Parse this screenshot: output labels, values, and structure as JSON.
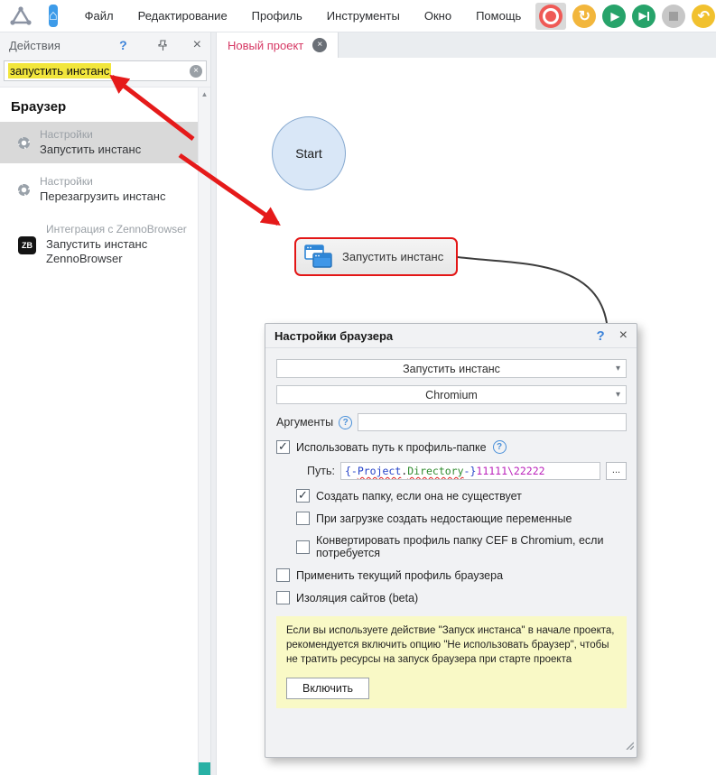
{
  "titlebar": {
    "menu": [
      "Файл",
      "Редактирование",
      "Профиль",
      "Инструменты",
      "Окно",
      "Помощь"
    ],
    "toolbar_icons": [
      "record",
      "restart",
      "play",
      "step",
      "stop",
      "undo",
      "redo",
      "hourglass",
      "profile"
    ]
  },
  "actions_panel": {
    "title": "Действия",
    "help_icon": "?",
    "search": {
      "value": "запустить инстанс"
    },
    "section_title": "Браузер",
    "items": [
      {
        "category": "Настройки",
        "label": "Запустить инстанс",
        "icon": "gear-icon",
        "selected": true
      },
      {
        "category": "Настройки",
        "label": "Перезагрузить инстанс",
        "icon": "gear-icon",
        "selected": false
      },
      {
        "category": "Интеграция с ZennoBrowser",
        "label": "Запустить инстанс ZennoBrowser",
        "icon": "zb-icon",
        "badge": "ZB",
        "selected": false
      }
    ]
  },
  "canvas": {
    "tab_label": "Новый проект",
    "start_node_label": "Start",
    "action_block_label": "Запустить инстанс"
  },
  "dialog": {
    "title": "Настройки браузера",
    "help_icon": "?",
    "action_select": "Запустить инстанс",
    "browser_select": "Chromium",
    "arguments_label": "Аргументы",
    "arguments_value": "",
    "use_profile_label": "Использовать путь к профиль-папке",
    "path_label": "Путь:",
    "path_segments": [
      {
        "text": "{-",
        "style": "macro"
      },
      {
        "text": "Project",
        "style": "macro-misspelled"
      },
      {
        "text": ".",
        "style": "plain"
      },
      {
        "text": "Directory",
        "style": "name-misspelled"
      },
      {
        "text": "-}",
        "style": "macro"
      },
      {
        "text": "11111\\22222",
        "style": "value"
      }
    ],
    "browse_button": "...",
    "checkboxes": [
      {
        "label": "Создать папку, если она не существует",
        "checked": true,
        "indent": true
      },
      {
        "label": "При загрузке создать недостающие переменные",
        "checked": false,
        "indent": true
      },
      {
        "label": "Конвертировать профиль папку CEF в Chromium, если потребуется",
        "checked": false,
        "indent": true
      },
      {
        "label": "Применить текущий профиль браузера",
        "checked": false,
        "indent": false
      },
      {
        "label": "Изоляция сайтов (beta)",
        "checked": false,
        "indent": false
      }
    ],
    "info_text": "Если вы используете действие \"Запуск инстанса\" в начале проекта, рекомендуется включить опцию \"Не использовать браузер\", чтобы не тратить ресурсы на запуск браузера при старте проекта",
    "enable_button": "Включить"
  },
  "icons": {
    "search_clear": "×",
    "close": "×",
    "pin": "push-pin",
    "help": "?",
    "dropdown_arrow": "▾",
    "check": "✓",
    "scroll_up": "▲",
    "home": "⌂"
  },
  "colors": {
    "accent_blue": "#3d9be9",
    "annotation_red": "#e51a1a",
    "block_border_red": "#e31616",
    "tab_red": "#d63864",
    "highlight_yellow": "#f2e63c",
    "info_bg": "#f9f9c6",
    "selected_item_bg": "#d9d9d9",
    "teal_accent": "#28b1a5"
  }
}
